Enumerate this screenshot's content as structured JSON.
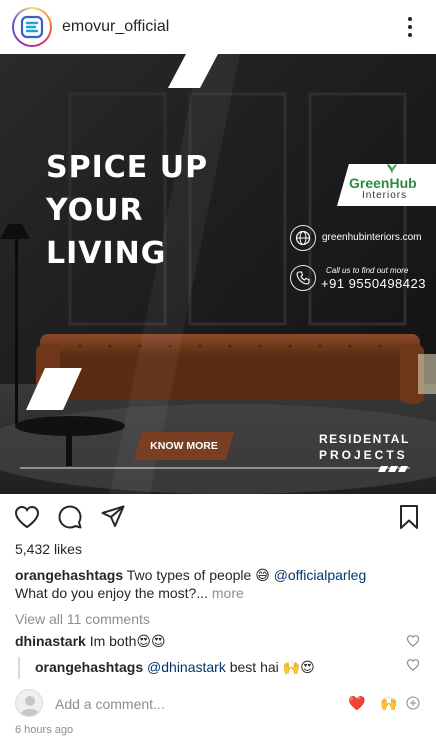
{
  "header": {
    "username": "emovur_official"
  },
  "post": {
    "headline": [
      "SPICE UP",
      "YOUR",
      "LIVING"
    ],
    "brand": {
      "name": "GreenHub",
      "sub": "Interiors"
    },
    "website": "greenhubinteriors.com",
    "call_label": "Call us to find out more",
    "phone": "+91 9550498423",
    "cta": "KNOW MORE",
    "tagline": [
      "RESIDENTAL",
      "PROJECTS"
    ]
  },
  "engagement": {
    "likes_count": "5,432",
    "likes_label": "likes"
  },
  "caption": {
    "user": "orangehashtags",
    "text": "Two types of people 😅",
    "mention": "@officialparleg",
    "line2": "What do you enjoy the most?...",
    "more": "more"
  },
  "comments": {
    "view_all": "View all 11 comments",
    "items": [
      {
        "user": "dhinastark",
        "text": "Im both😍😍"
      }
    ],
    "reply": {
      "user": "orangehashtags",
      "mention": "@dhinastark",
      "text": "best hai 🙌😍"
    }
  },
  "composer": {
    "placeholder": "Add a comment...",
    "quick_reactions": [
      "❤️",
      "🙌"
    ]
  },
  "timestamp": "6 hours ago",
  "colors": {
    "text": "#262626",
    "muted": "#8e8e8e",
    "link": "#00376b",
    "brand_green": "#2e8b3e",
    "cta_brown": "#7a3e22"
  }
}
